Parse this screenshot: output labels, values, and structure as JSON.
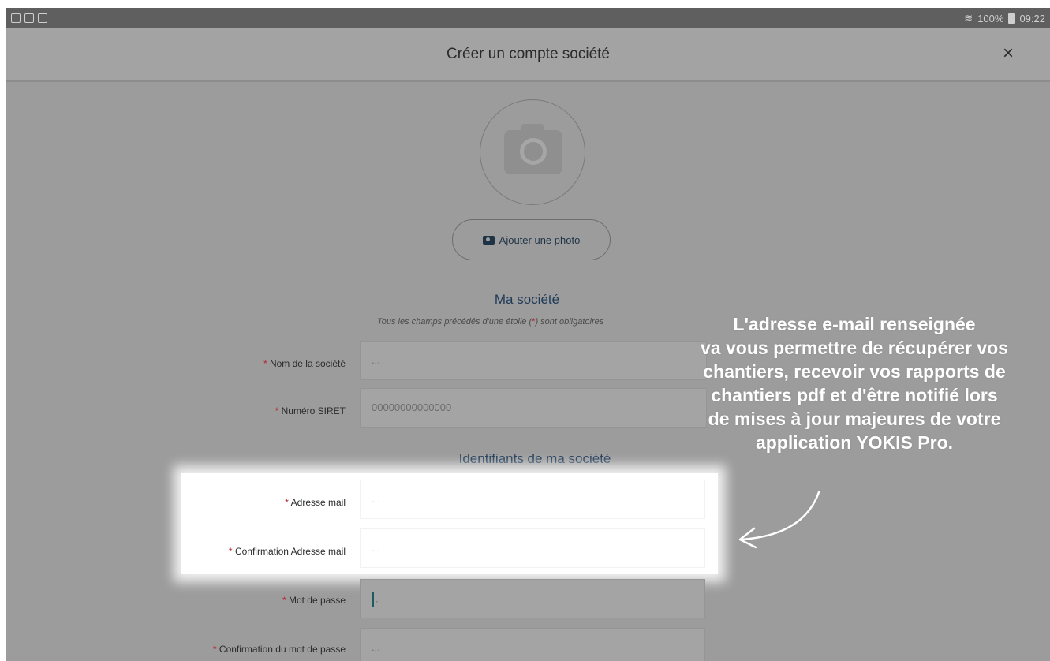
{
  "status_bar": {
    "battery": "100%",
    "time": "09:22"
  },
  "header": {
    "title": "Créer un compte société",
    "close_symbol": "×"
  },
  "photo": {
    "add_photo_label": "Ajouter une photo",
    "placeholder_icon": "camera-icon"
  },
  "section_company": {
    "title": "Ma société",
    "note_prefix": "Tous les champs précédés d'une étoile (",
    "note_star": "*",
    "note_suffix": ") sont obligatoires"
  },
  "fields": {
    "company_name": {
      "label": "Nom de la société",
      "value": "..."
    },
    "siret": {
      "label": "Numéro SIRET",
      "value": "00000000000000"
    }
  },
  "section_credentials": {
    "title": "Identifiants de ma société"
  },
  "credentials": {
    "email": {
      "label": "Adresse mail",
      "value": "..."
    },
    "email_confirm": {
      "label": "Confirmation Adresse mail",
      "value": "..."
    },
    "password": {
      "label": "Mot de passe",
      "value": "."
    },
    "password_confirm": {
      "label": "Confirmation du mot de passe",
      "value": "..."
    }
  },
  "required_star": "*",
  "annotation": {
    "line1": "L'adresse e-mail renseignée",
    "line2": "va vous permettre de récupérer vos",
    "line3": "chantiers, recevoir vos rapports de",
    "line4": "chantiers pdf et d'être notifié lors",
    "line5": "de mises à jour majeures de votre",
    "line6": "application YOKIS Pro."
  },
  "colors": {
    "overlay": "#9c9c9c",
    "accent_text": "#1f3a58",
    "required": "#b3262b",
    "annotation_text": "#ffffff"
  }
}
